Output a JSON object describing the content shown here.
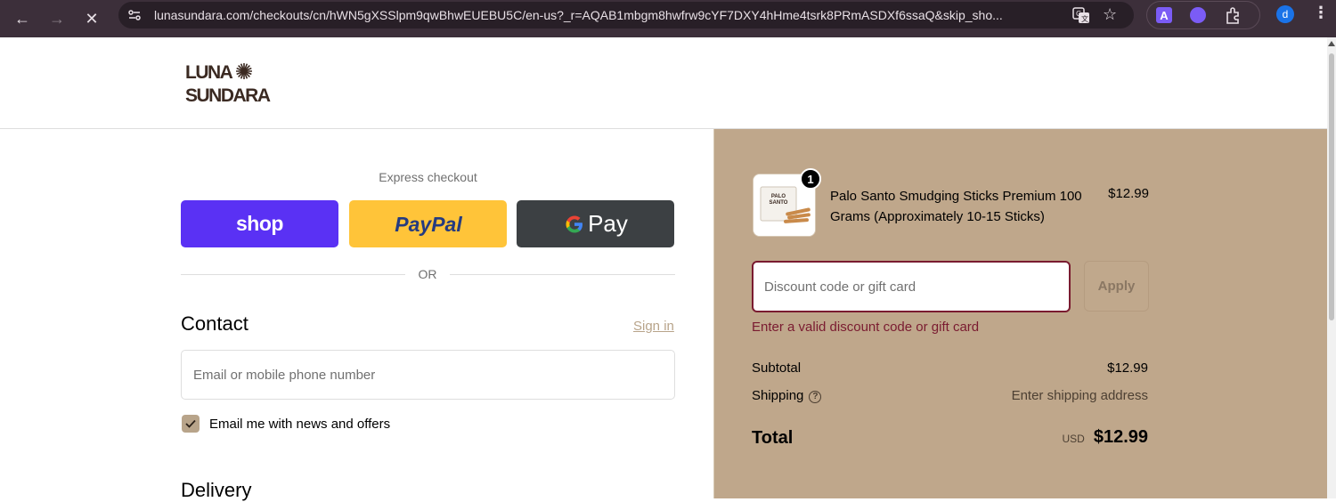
{
  "browser": {
    "url": "lunasundara.com/checkouts/cn/hWN5gXSSlpm9qwBhwEUEBU5C/en-us?_r=AQAB1mbgm8hwfrw9cYF7DXY4hHme4tsrk8PRmASDXf6ssaQ&skip_sho...",
    "extension_a_label": "A",
    "profile_initial": "d"
  },
  "header": {
    "logo_line1": "LUNA",
    "logo_line2": "SUNDARA"
  },
  "express": {
    "label": "Express checkout",
    "shop_label": "shop",
    "paypal_label": "PayPal",
    "gpay_label": "Pay",
    "or_text": "OR"
  },
  "contact": {
    "heading": "Contact",
    "signin_label": "Sign in",
    "email_placeholder": "Email or mobile phone number",
    "newsletter_label": "Email me with news and offers",
    "newsletter_checked": true
  },
  "delivery": {
    "heading": "Delivery"
  },
  "summary": {
    "product": {
      "name": "Palo Santo Smudging Sticks Premium 100 Grams (Approximately 10-15 Sticks)",
      "price": "$12.99",
      "quantity": "1",
      "thumb_label_1": "PALO",
      "thumb_label_2": "SANTO"
    },
    "discount_placeholder": "Discount code or gift card",
    "apply_label": "Apply",
    "error": "Enter a valid discount code or gift card",
    "subtotal_label": "Subtotal",
    "subtotal_value": "$12.99",
    "shipping_label": "Shipping",
    "shipping_value": "Enter shipping address",
    "total_label": "Total",
    "currency": "USD",
    "total_value": "$12.99"
  },
  "colors": {
    "summary_bg": "#bfa78b",
    "accent": "#b8a48a",
    "error": "#7a1b30",
    "shop_pay": "#5a31f4",
    "paypal": "#ffc439",
    "gpay": "#3c4043"
  }
}
